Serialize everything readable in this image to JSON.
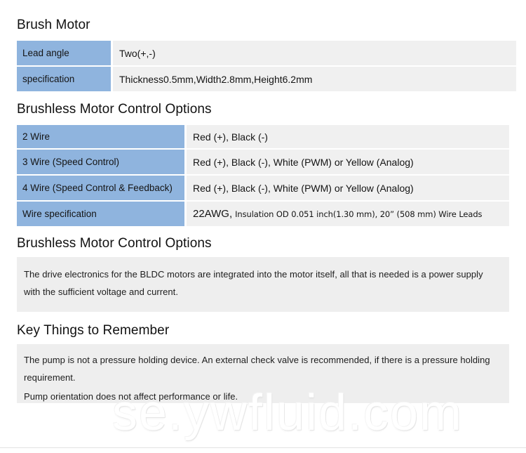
{
  "colors": {
    "key_cell_blue": "#8fb4de",
    "value_cell_gray": "#f0f0f0",
    "note_box_gray": "#eeeeee",
    "heading_text": "#111111",
    "body_text": "#1d1d1d",
    "footer_rule": "#e2e2e2"
  },
  "sections": {
    "brush_motor": {
      "heading": "Brush Motor",
      "rows": [
        {
          "key": "Lead angle",
          "value": "Two(+,-)"
        },
        {
          "key": "specification",
          "value": "Thickness0.5mm,Width2.8mm,Height6.2mm"
        }
      ]
    },
    "brushless_options_table": {
      "heading": "Brushless Motor Control Options",
      "rows": [
        {
          "key": "2 Wire",
          "value": "Red (+), Black (-)"
        },
        {
          "key": "3 Wire (Speed Control)",
          "value": "Red (+), Black (-), White (PWM) or Yellow (Analog)"
        },
        {
          "key": "4 Wire (Speed Control & Feedback)",
          "value": "Red (+), Black (-), White (PWM) or Yellow (Analog)"
        },
        {
          "key": "Wire specification",
          "value_big": "22AWG,",
          "value_small": "Insulation OD 0.051 inch(1.30 mm), 20” (508 mm) Wire Leads"
        }
      ]
    },
    "brushless_options_note": {
      "heading": "Brushless Motor Control Options",
      "paragraphs": [
        "The drive electronics for the BLDC motors are integrated into the motor itself, all that is needed is a power supply with the sufficient voltage and current."
      ]
    },
    "key_things": {
      "heading": "Key Things to Remember",
      "paragraphs": [
        "The pump is not a pressure holding device. An external check valve is recommended, if there is a pressure holding requirement.",
        "Pump orientation does not affect performance or life."
      ]
    }
  },
  "watermark": {
    "text": "se.ywfluid.com"
  }
}
